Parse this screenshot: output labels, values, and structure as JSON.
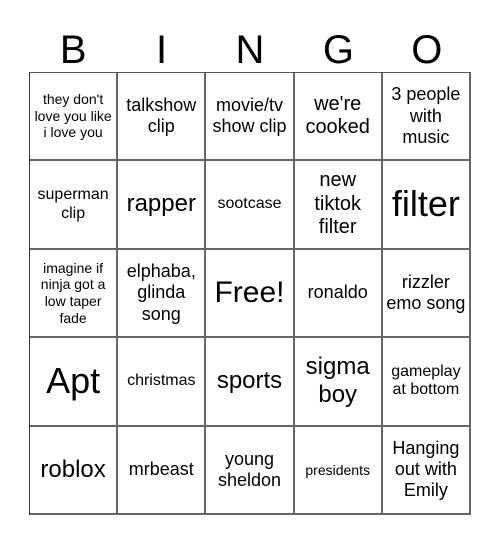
{
  "title_letters": [
    "B",
    "I",
    "N",
    "G",
    "O"
  ],
  "cells": [
    [
      "they don't love you like i love you",
      "talkshow clip",
      "movie/tv show clip",
      "we're cooked",
      "3 people with music"
    ],
    [
      "superman clip",
      "rapper",
      "sootcase",
      "new tiktok filter",
      "filter"
    ],
    [
      "imagine if ninja got a low taper fade",
      "elphaba, glinda song",
      "Free!",
      "ronaldo",
      "rizzler emo song"
    ],
    [
      "Apt",
      "christmas",
      "sports",
      "sigma boy",
      "gameplay at bottom"
    ],
    [
      "roblox",
      "mrbeast",
      "young sheldon",
      "presidents",
      "Hanging out with Emily"
    ]
  ],
  "free_space": {
    "row": 2,
    "col": 2
  }
}
